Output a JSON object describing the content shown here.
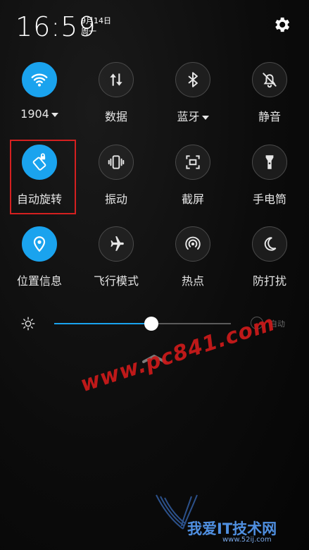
{
  "status": {
    "time": "16:59",
    "date": "9月14日",
    "weekday": "周一"
  },
  "tiles": [
    {
      "label": "1904",
      "icon": "wifi-icon",
      "active": true,
      "caret": true
    },
    {
      "label": "数据",
      "icon": "data-icon",
      "active": false
    },
    {
      "label": "蓝牙",
      "icon": "bluetooth-icon",
      "active": false,
      "caret": true
    },
    {
      "label": "静音",
      "icon": "mute-icon",
      "active": false
    },
    {
      "label": "自动旋转",
      "icon": "auto-rotate-icon",
      "active": true
    },
    {
      "label": "振动",
      "icon": "vibrate-icon",
      "active": false
    },
    {
      "label": "截屏",
      "icon": "screenshot-icon",
      "active": false
    },
    {
      "label": "手电筒",
      "icon": "flashlight-icon",
      "active": false
    },
    {
      "label": "位置信息",
      "icon": "location-icon",
      "active": true
    },
    {
      "label": "飞行模式",
      "icon": "airplane-icon",
      "active": false
    },
    {
      "label": "热点",
      "icon": "hotspot-icon",
      "active": false
    },
    {
      "label": "防打扰",
      "icon": "do-not-disturb-icon",
      "active": false
    }
  ],
  "brightness": {
    "level": 0.55,
    "auto_label": "自动"
  },
  "watermark": {
    "text": "www.pc841.com",
    "logo_text": "我爱IT技术网",
    "logo_url": "www.52ij.com"
  },
  "colors": {
    "accent": "#1aa3ee",
    "highlight": "#d42020",
    "watermark": "#c81a1a"
  }
}
